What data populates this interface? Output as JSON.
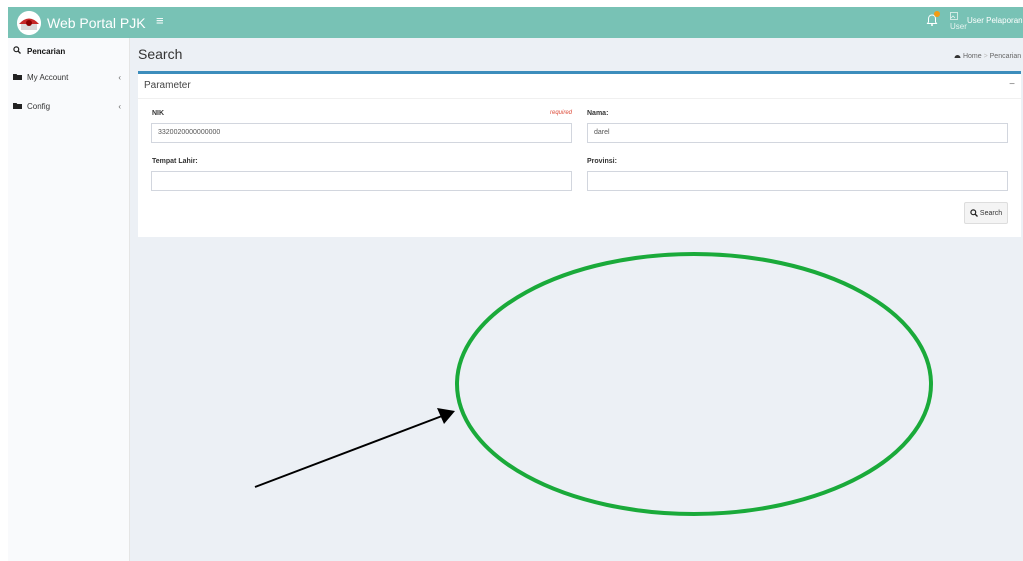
{
  "topbar": {
    "app_title": "Web Portal PJK",
    "menu_icon": "≡",
    "user_image_alt": "User",
    "user_name": "User Pelaporan"
  },
  "sidebar": {
    "items": [
      {
        "label": "Pencarian",
        "icon": "search-icon",
        "active": true
      },
      {
        "label": "My Account",
        "icon": "folder-icon",
        "chevron": "‹"
      },
      {
        "label": "Config",
        "icon": "folder-icon",
        "chevron": "‹"
      }
    ]
  },
  "header": {
    "title": "Search",
    "breadcrumb_home": "Home",
    "breadcrumb_separator": ">",
    "breadcrumb_current": "Pencarian"
  },
  "form": {
    "panel_title": "Parameter",
    "collapse_symbol": "−",
    "nik_label": "NIK",
    "nik_required": "required",
    "nik_value": "3320020000000000",
    "nama_label": "Nama:",
    "nama_value": "darel",
    "tempat_lahir_label": "Tempat Lahir:",
    "tempat_lahir_value": "",
    "provinsi_label": "Provinsi:",
    "provinsi_value": "",
    "search_button": "Search"
  },
  "colors": {
    "topbar": "#78c2b5",
    "box_border": "#3c8dbc",
    "annotation_ellipse": "#1aaa3a",
    "annotation_arrow": "#000000"
  }
}
